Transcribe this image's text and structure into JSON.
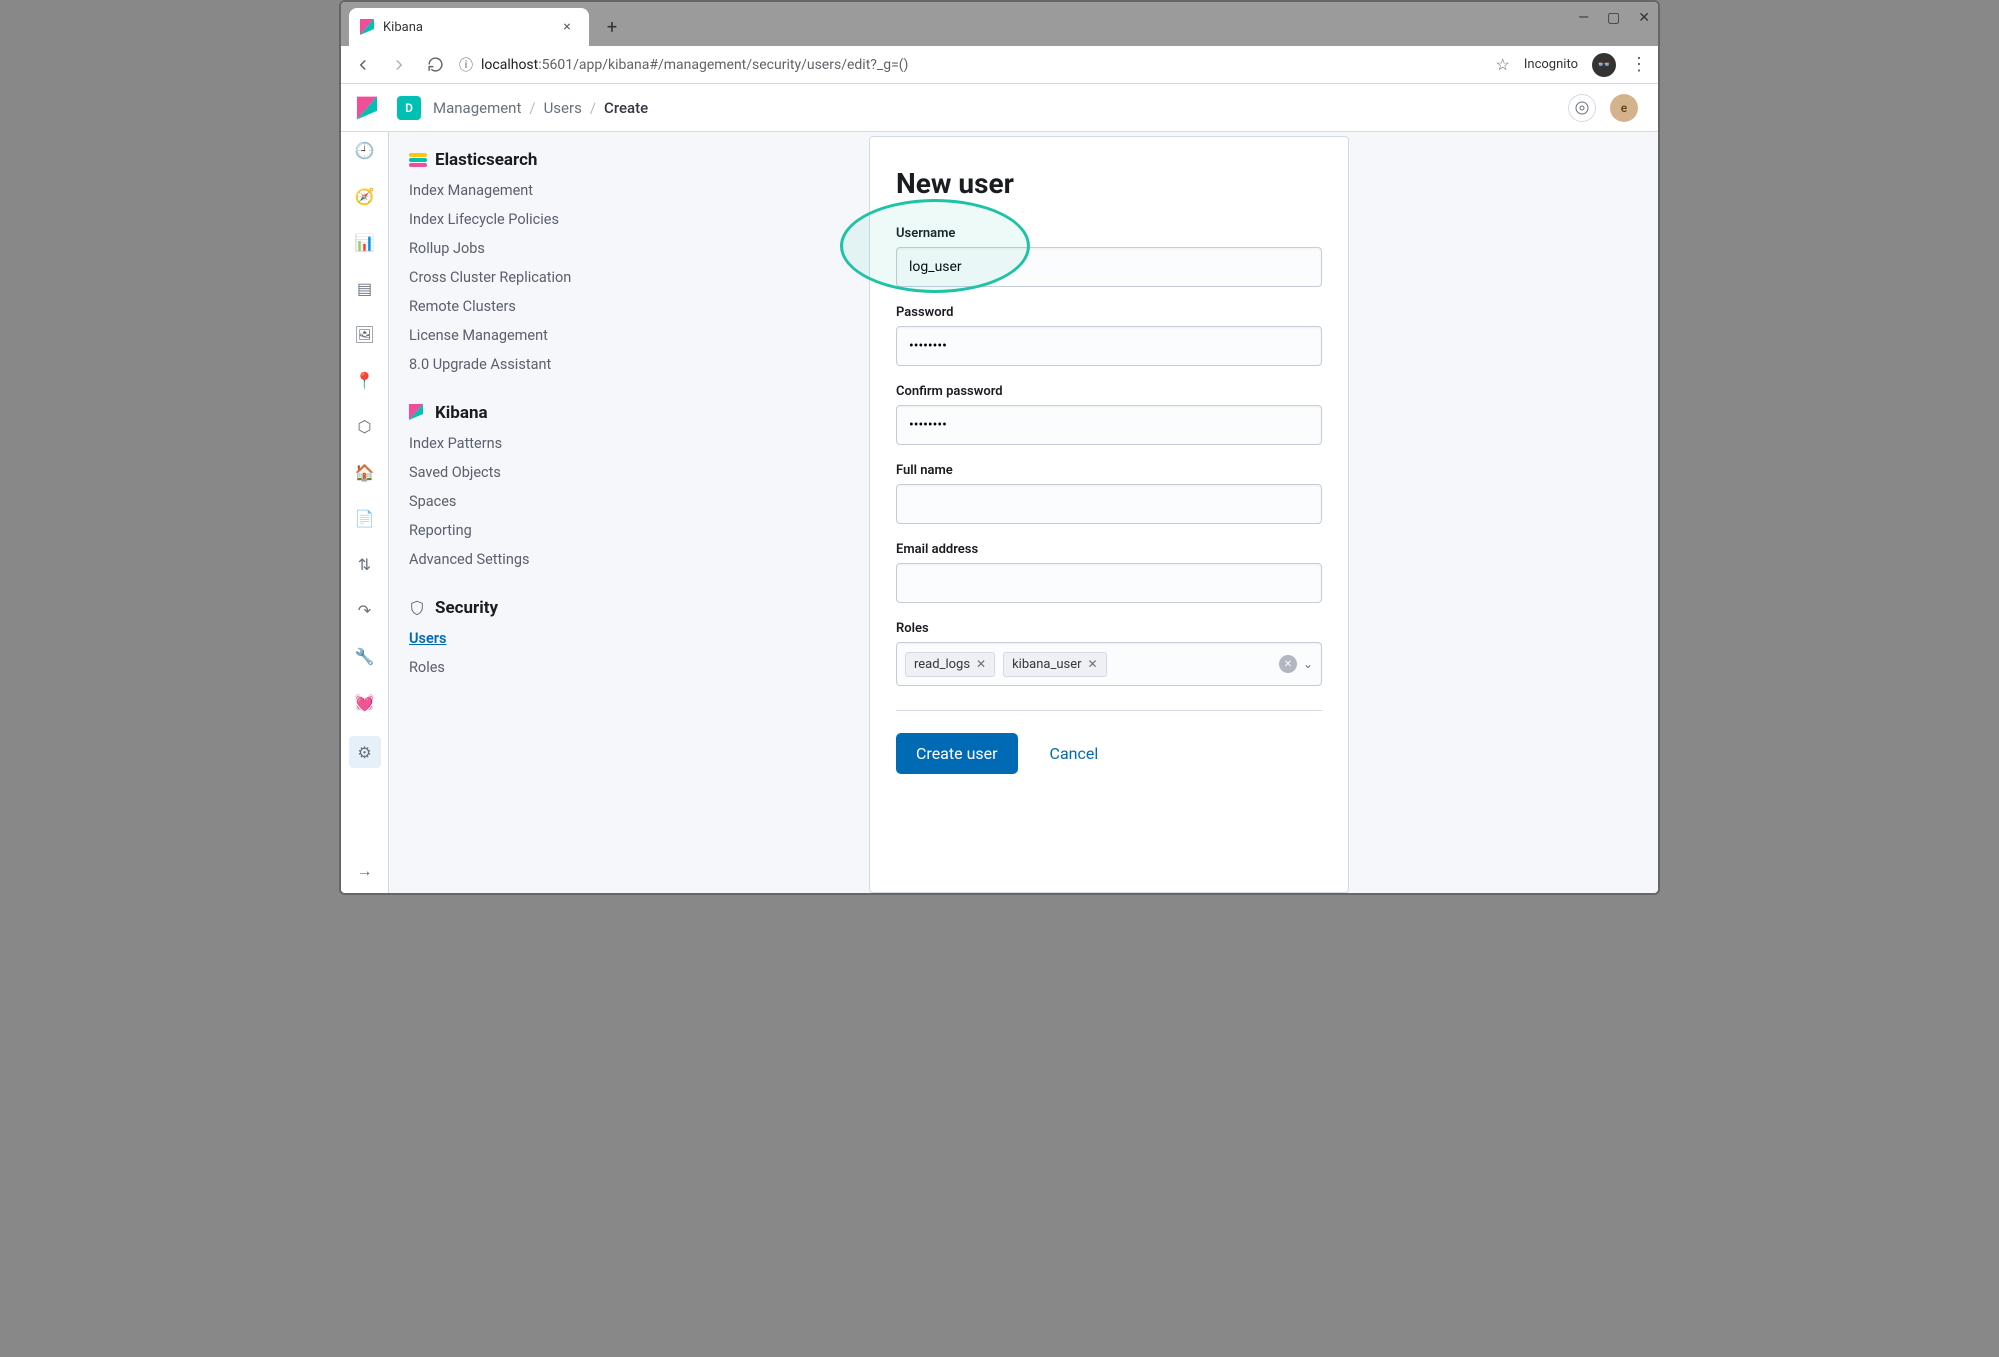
{
  "browser": {
    "tab_title": "Kibana",
    "url_prefix": "localhost",
    "url_rest": ":5601/app/kibana#/management/security/users/edit?_g=()",
    "incognito_label": "Incognito"
  },
  "header": {
    "space_letter": "D",
    "breadcrumbs": [
      "Management",
      "Users",
      "Create"
    ],
    "avatar_letter": "e"
  },
  "mgmt_nav": {
    "sections": [
      {
        "title": "Elasticsearch",
        "items": [
          "Index Management",
          "Index Lifecycle Policies",
          "Rollup Jobs",
          "Cross Cluster Replication",
          "Remote Clusters",
          "License Management",
          "8.0 Upgrade Assistant"
        ]
      },
      {
        "title": "Kibana",
        "items": [
          "Index Patterns",
          "Saved Objects",
          "Spaces",
          "Reporting",
          "Advanced Settings"
        ]
      },
      {
        "title": "Security",
        "items": [
          "Users",
          "Roles"
        ],
        "active": "Users"
      }
    ]
  },
  "form": {
    "title": "New user",
    "username_label": "Username",
    "username_value": "log_user",
    "password_label": "Password",
    "password_value": "••••••••",
    "confirm_label": "Confirm password",
    "confirm_value": "••••••••",
    "fullname_label": "Full name",
    "fullname_value": "",
    "email_label": "Email address",
    "email_value": "",
    "roles_label": "Roles",
    "roles": [
      "read_logs",
      "kibana_user"
    ],
    "create_label": "Create user",
    "cancel_label": "Cancel"
  }
}
